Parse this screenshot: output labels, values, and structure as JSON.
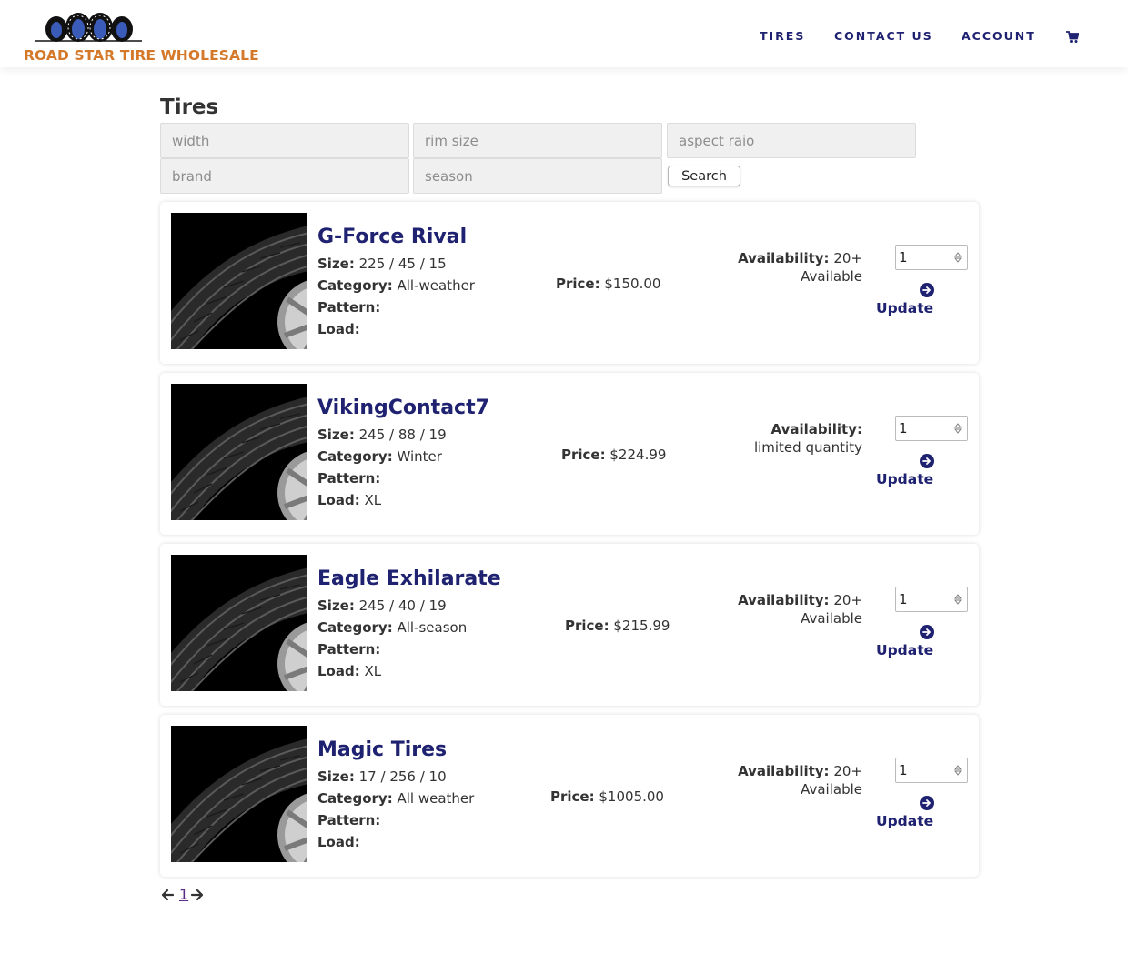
{
  "brand": {
    "name": "ROAD STAR TIRE WHOLESALE",
    "accent_color": "#d4782a",
    "nav_color": "#1f2270"
  },
  "nav": {
    "tires": "TIRES",
    "contact": "CONTACT US",
    "account": "ACCOUNT",
    "cart_icon": "cart-icon"
  },
  "page": {
    "title": "Tires"
  },
  "filters": {
    "width": "width",
    "rim_size": "rim size",
    "aspect_ratio": "aspect raio",
    "brand": "brand",
    "season": "season",
    "search_label": "Search"
  },
  "labels": {
    "size": "Size:",
    "category": "Category:",
    "pattern": "Pattern:",
    "load": "Load:",
    "price": "Price:",
    "availability": "Availability:",
    "update": "Update"
  },
  "products": [
    {
      "name": "G-Force Rival",
      "size": "225 / 45 / 15",
      "category": "All-weather",
      "pattern": "",
      "load": "",
      "price": "$150.00",
      "availability": "20+",
      "availability_note": "Available",
      "qty": "1"
    },
    {
      "name": "VikingContact7",
      "size": "245 / 88 / 19",
      "category": "Winter",
      "pattern": "",
      "load": "XL",
      "price": "$224.99",
      "availability": "",
      "availability_note": "limited quantity",
      "qty": "1"
    },
    {
      "name": "Eagle Exhilarate",
      "size": "245 / 40 / 19",
      "category": "All-season",
      "pattern": "",
      "load": "XL",
      "price": "$215.99",
      "availability": "20+",
      "availability_note": "Available",
      "qty": "1"
    },
    {
      "name": "Magic Tires",
      "size": "17 / 256 / 10",
      "category": "All weather",
      "pattern": "",
      "load": "",
      "price": "$1005.00",
      "availability": "20+",
      "availability_note": "Available",
      "qty": "1"
    }
  ],
  "pagination": {
    "current": "1"
  }
}
